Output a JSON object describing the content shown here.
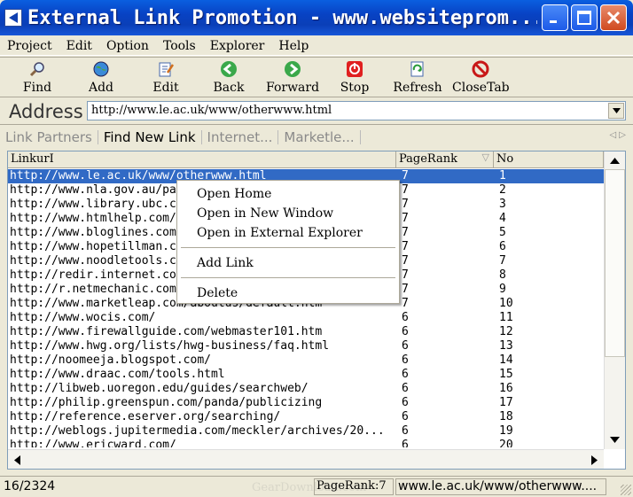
{
  "window": {
    "title": "External Link Promotion - www.websiteprom..."
  },
  "menu": [
    "Project",
    "Edit",
    "Option",
    "Tools",
    "Explorer",
    "Help"
  ],
  "toolbar": [
    {
      "label": "Find",
      "icon": "magnifier-icon"
    },
    {
      "label": "Add",
      "icon": "globe-icon"
    },
    {
      "label": "Edit",
      "icon": "edit-page-icon"
    },
    {
      "label": "Back",
      "icon": "back-arrow-icon"
    },
    {
      "label": "Forward",
      "icon": "forward-arrow-icon"
    },
    {
      "label": "Stop",
      "icon": "stop-icon"
    },
    {
      "label": "Refresh",
      "icon": "refresh-icon"
    },
    {
      "label": "CloseTab",
      "icon": "no-entry-icon"
    }
  ],
  "address": {
    "label": "Address",
    "value": "http://www.le.ac.uk/www/otherwww.html"
  },
  "tabs": [
    "Link Partners",
    "Find New Link",
    "Internet...",
    "Marketle..."
  ],
  "table": {
    "columns": [
      "LinkurI",
      "PageRank",
      "No"
    ],
    "rows": [
      {
        "url": "http://www.le.ac.uk/www/otherwww.html",
        "pr": "7",
        "no": "1"
      },
      {
        "url": "http://www.nla.gov.au/pa",
        "pr": "7",
        "no": "2"
      },
      {
        "url": "http://www.library.ubc.c",
        "pr": "7",
        "no": "3"
      },
      {
        "url": "http://www.htmlhelp.com/",
        "pr": "7",
        "no": "4"
      },
      {
        "url": "http://www.bloglines.com",
        "pr": "7",
        "no": "5"
      },
      {
        "url": "http://www.hopetillman.c",
        "pr": "7",
        "no": "6"
      },
      {
        "url": "http://www.noodletools.c",
        "pr": "7",
        "no": "7"
      },
      {
        "url": "http://redir.internet.co",
        "pr": "7",
        "no": "8"
      },
      {
        "url": "http://r.netmechanic.com",
        "pr": "7",
        "no": "9"
      },
      {
        "url": "http://www.marketleap.com/aboutus/default.htm",
        "pr": "7",
        "no": "10"
      },
      {
        "url": "http://www.wocis.com/",
        "pr": "6",
        "no": "11"
      },
      {
        "url": "http://www.firewallguide.com/webmaster101.htm",
        "pr": "6",
        "no": "12"
      },
      {
        "url": "http://www.hwg.org/lists/hwg-business/faq.html",
        "pr": "6",
        "no": "13"
      },
      {
        "url": "http://noomeeja.blogspot.com/",
        "pr": "6",
        "no": "14"
      },
      {
        "url": "http://www.draac.com/tools.html",
        "pr": "6",
        "no": "15"
      },
      {
        "url": "http://libweb.uoregon.edu/guides/searchweb/",
        "pr": "6",
        "no": "16"
      },
      {
        "url": "http://philip.greenspun.com/panda/publicizing",
        "pr": "6",
        "no": "17"
      },
      {
        "url": "http://reference.eserver.org/searching/",
        "pr": "6",
        "no": "18"
      },
      {
        "url": "http://weblogs.jupitermedia.com/meckler/archives/20...",
        "pr": "6",
        "no": "19"
      },
      {
        "url": "http://www.ericward.com/",
        "pr": "6",
        "no": "20"
      }
    ]
  },
  "context_menu": {
    "items": [
      "Open Home",
      "Open in New Window",
      "Open in External Explorer",
      "Add Link",
      "Delete"
    ]
  },
  "status": {
    "count": "16/2324",
    "pagerank": "PageRank:7",
    "url": "www.le.ac.uk/www/otherwww...."
  },
  "watermark": "GearDownload.com",
  "colors": {
    "titlebar": "#0a46c8",
    "selection": "#316ac5",
    "face": "#ece9d8"
  }
}
